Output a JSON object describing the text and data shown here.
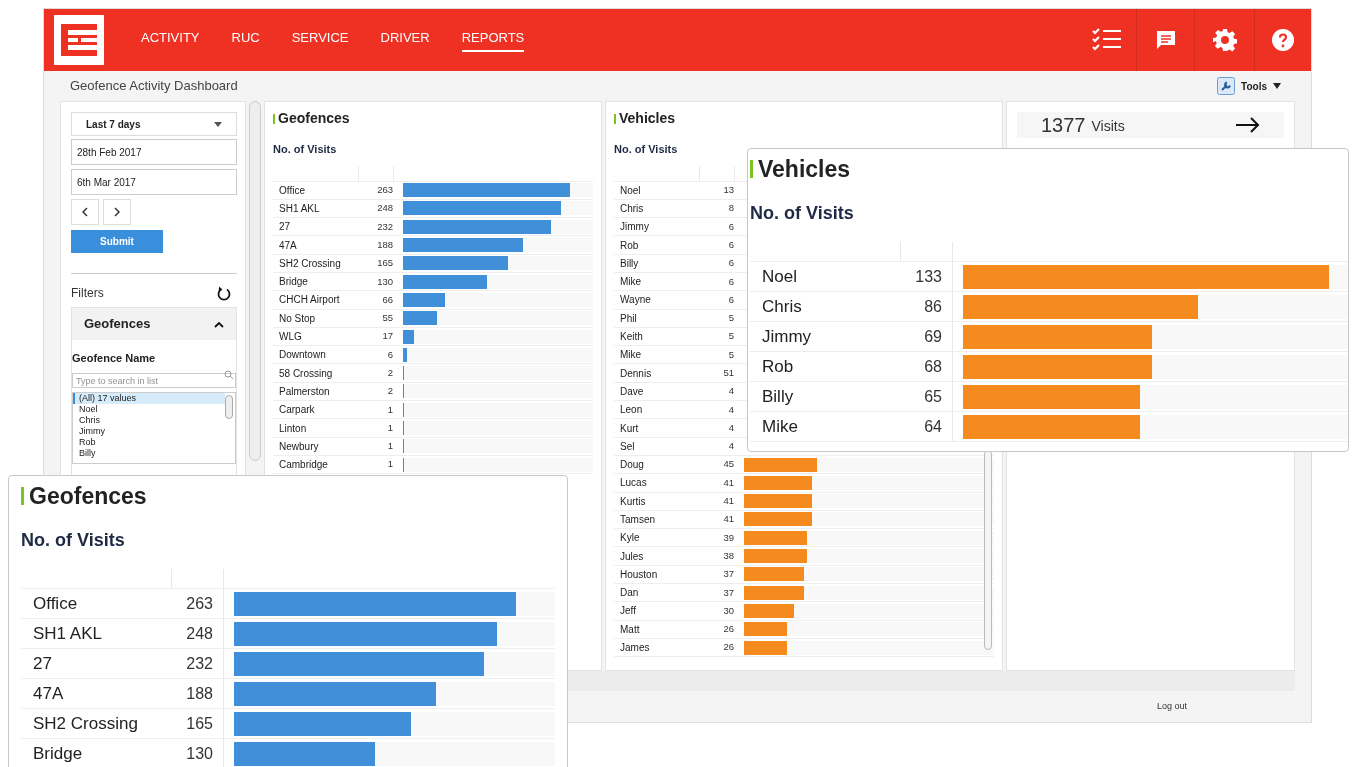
{
  "header": {
    "nav": [
      {
        "label": "ACTIVITY",
        "selected": false
      },
      {
        "label": "RUC",
        "selected": false
      },
      {
        "label": "SERVICE",
        "selected": false
      },
      {
        "label": "DRIVER",
        "selected": false
      },
      {
        "label": "REPORTS",
        "selected": true
      }
    ]
  },
  "page_title": "Geofence Activity Dashboard",
  "tools_button": "Tools",
  "sidebar": {
    "period": "Last 7 days",
    "start_date": "28th Feb 2017",
    "end_date": "6th Mar 2017",
    "submit": "Submit",
    "filters_label": "Filters",
    "filter_section": {
      "title": "Geofences",
      "expanded": true
    },
    "field_label": "Geofence Name",
    "search_placeholder": "Type to search in list",
    "list": [
      {
        "label": "(All) 17 values",
        "selected": true
      },
      {
        "label": "Noel",
        "selected": false
      },
      {
        "label": "Chris",
        "selected": false
      },
      {
        "label": "Jimmy",
        "selected": false
      },
      {
        "label": "Rob",
        "selected": false
      },
      {
        "label": "Billy",
        "selected": false
      }
    ]
  },
  "geofences_panel": {
    "title": "Geofences",
    "subtitle": "No. of Visits",
    "rows": [
      {
        "name": "Office",
        "visits": "263",
        "level": 0.88
      },
      {
        "name": "SH1 AKL",
        "visits": "248",
        "level": 0.83
      },
      {
        "name": "27",
        "visits": "232",
        "level": 0.78
      },
      {
        "name": "47A",
        "visits": "188",
        "level": 0.63
      },
      {
        "name": "SH2 Crossing",
        "visits": "165",
        "level": 0.55
      },
      {
        "name": "Bridge",
        "visits": "130",
        "level": 0.44
      },
      {
        "name": "CHCH Airport",
        "visits": "66",
        "level": 0.22
      },
      {
        "name": "No Stop",
        "visits": "55",
        "level": 0.18
      },
      {
        "name": "WLG",
        "visits": "17",
        "level": 0.06
      },
      {
        "name": "Downtown",
        "visits": "6",
        "level": 0.02
      },
      {
        "name": "58 Crossing",
        "visits": "2",
        "level": 0.007
      },
      {
        "name": "Palmerston",
        "visits": "2",
        "level": 0.007
      },
      {
        "name": "Carpark",
        "visits": "1",
        "level": 0.004
      },
      {
        "name": "Linton",
        "visits": "1",
        "level": 0.004
      },
      {
        "name": "Newbury",
        "visits": "1",
        "level": 0.004
      },
      {
        "name": "Cambridge",
        "visits": "1",
        "level": 0.004
      }
    ]
  },
  "vehicles_panel": {
    "title": "Vehicles",
    "subtitle": "No. of Visits",
    "rows": [
      {
        "name": "Noel",
        "visits": "13"
      },
      {
        "name": "Chris",
        "visits": "8"
      },
      {
        "name": "Jimmy",
        "visits": "6"
      },
      {
        "name": "Rob",
        "visits": "6"
      },
      {
        "name": "Billy",
        "visits": "6"
      },
      {
        "name": "Mike",
        "visits": "6"
      },
      {
        "name": "Wayne",
        "visits": "6"
      },
      {
        "name": "Phil",
        "visits": "5"
      },
      {
        "name": "Keith",
        "visits": "5"
      },
      {
        "name": "Mike",
        "visits": "5"
      },
      {
        "name": "Dennis",
        "visits": "51"
      },
      {
        "name": "Dave",
        "visits": "4"
      },
      {
        "name": "Leon",
        "visits": "4"
      },
      {
        "name": "Kurt",
        "visits": "4"
      },
      {
        "name": "Sel",
        "visits": "4"
      },
      {
        "name": "Doug",
        "visits": "45",
        "level": 0.29
      },
      {
        "name": "Lucas",
        "visits": "41",
        "level": 0.27
      },
      {
        "name": "Kurtis",
        "visits": "41",
        "level": 0.27
      },
      {
        "name": "Tamsen",
        "visits": "41",
        "level": 0.27
      },
      {
        "name": "Kyle",
        "visits": "39",
        "level": 0.25
      },
      {
        "name": "Jules",
        "visits": "38",
        "level": 0.25
      },
      {
        "name": "Houston",
        "visits": "37",
        "level": 0.24
      },
      {
        "name": "Dan",
        "visits": "37",
        "level": 0.24
      },
      {
        "name": "Jeff",
        "visits": "30",
        "level": 0.2
      },
      {
        "name": "Matt",
        "visits": "26",
        "level": 0.17
      },
      {
        "name": "James",
        "visits": "26",
        "level": 0.17
      }
    ]
  },
  "summary_card": {
    "count": "1377",
    "unit": "Visits"
  },
  "footer": {
    "logout": "Log out"
  },
  "callouts": [
    {
      "kind": "vehicles",
      "title": "Vehicles",
      "subtitle": "No. of Visits",
      "rows": [
        {
          "name": "Noel",
          "visits": "133",
          "level": 0.95
        },
        {
          "name": "Chris",
          "visits": "86",
          "level": 0.61
        },
        {
          "name": "Jimmy",
          "visits": "69",
          "level": 0.49
        },
        {
          "name": "Rob",
          "visits": "68",
          "level": 0.49
        },
        {
          "name": "Billy",
          "visits": "65",
          "level": 0.46
        },
        {
          "name": "Mike",
          "visits": "64",
          "level": 0.46
        }
      ]
    },
    {
      "kind": "geofences",
      "title": "Geofences",
      "subtitle": "No. of Visits",
      "rows": [
        {
          "name": "Office",
          "visits": "263",
          "level": 0.88
        },
        {
          "name": "SH1 AKL",
          "visits": "248",
          "level": 0.82
        },
        {
          "name": "27",
          "visits": "232",
          "level": 0.78
        },
        {
          "name": "47A",
          "visits": "188",
          "level": 0.63
        },
        {
          "name": "SH2 Crossing",
          "visits": "165",
          "level": 0.55
        },
        {
          "name": "Bridge",
          "visits": "130",
          "level": 0.44
        }
      ]
    }
  ]
}
